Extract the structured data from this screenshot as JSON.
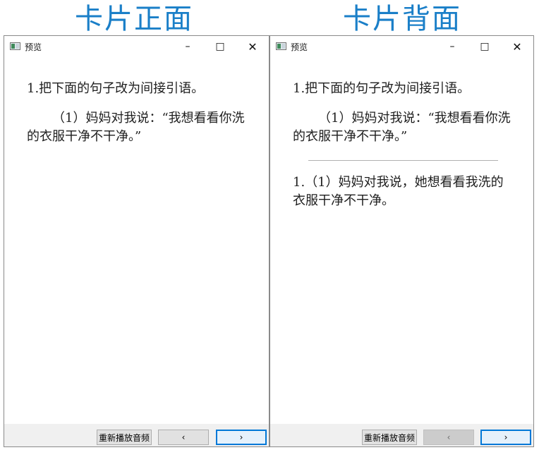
{
  "captions": {
    "front": "卡片正面",
    "back": "卡片背面"
  },
  "front_window": {
    "title": "预览",
    "controls": {
      "minimize": "–",
      "maximize": "□",
      "close": "✕"
    },
    "question_title": "1.把下面的句子改为间接引语。",
    "question_body": "（1）妈妈对我说：“我想看看你洗的衣服干净不干净。”",
    "buttons": {
      "replay": "重新播放音频",
      "prev": "‹",
      "next": "›"
    }
  },
  "back_window": {
    "title": "预览",
    "controls": {
      "minimize": "–",
      "maximize": "□",
      "close": "✕"
    },
    "question_title": "1.把下面的句子改为间接引语。",
    "question_body": "（1）妈妈对我说：“我想看看你洗的衣服干净不干净。”",
    "answer": "1.（1）妈妈对我说，她想看看我洗的衣服干净不干净。",
    "buttons": {
      "replay": "重新播放音频",
      "prev": "‹",
      "next": "›"
    }
  }
}
